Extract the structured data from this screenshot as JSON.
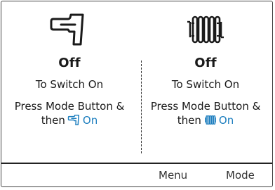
{
  "left_panel": {
    "icon": "tap-icon",
    "status": "Off",
    "instruction_1": "To Switch On",
    "instruction_2": "Press Mode Button &",
    "instruction_3_prefix": "then",
    "instruction_3_icon": "tap-icon",
    "instruction_3_suffix": "On"
  },
  "right_panel": {
    "icon": "radiator-icon",
    "status": "Off",
    "instruction_1": "To Switch On",
    "instruction_2": "Press Mode Button &",
    "instruction_3_prefix": "then",
    "instruction_3_icon": "radiator-icon",
    "instruction_3_suffix": "On"
  },
  "softkeys": {
    "menu": "Menu",
    "mode": "Mode"
  },
  "colors": {
    "accent_on": "#1e7fbf",
    "text": "#1a1a1a",
    "border": "#444444"
  }
}
